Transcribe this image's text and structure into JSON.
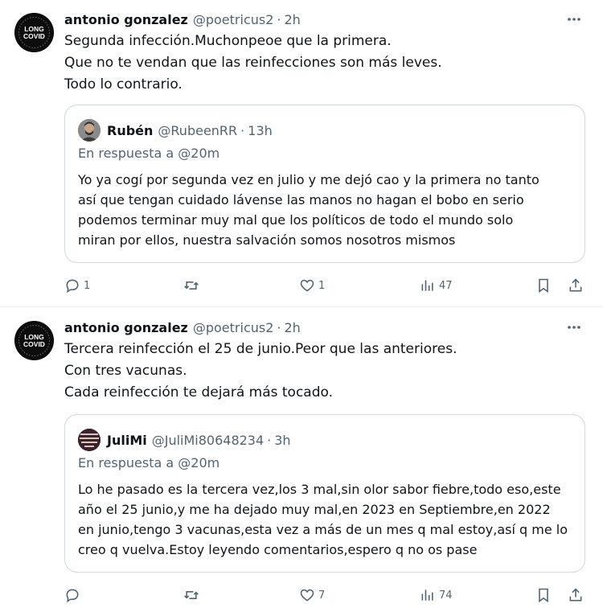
{
  "tweets": [
    {
      "author_name": "antonio gonzalez",
      "author_handle": "@poetricus2",
      "separator": "·",
      "time": "2h",
      "avatar_text": [
        "LONG",
        "COVID"
      ],
      "lines": [
        "Segunda infección.Muchonpeoe que la primera.",
        "Que no te vendan que las reinfecciones son más leves.",
        "Todo lo contrario."
      ],
      "quote": {
        "author_name": "Rubén",
        "author_handle": "@RubeenRR",
        "separator": "·",
        "time": "13h",
        "reply_to": "En respuesta a @20m",
        "lines": [
          "Yo ya cogí por segunda vez en julio y me dejó cao y la primera no tanto",
          "así que tengan cuidado lávense las manos no hagan el bobo en serio",
          "podemos terminar muy mal que los políticos de todo el mundo solo",
          "miran por ellos, nuestra salvación somos nosotros mismos"
        ]
      },
      "counts": {
        "replies": "1",
        "retweets": "",
        "likes": "1",
        "views": "47"
      }
    },
    {
      "author_name": "antonio gonzalez",
      "author_handle": "@poetricus2",
      "separator": "·",
      "time": "2h",
      "avatar_text": [
        "LONG",
        "COVID"
      ],
      "lines": [
        "Tercera reinfección el 25 de junio.Peor que las anteriores.",
        "Con tres vacunas.",
        "Cada reinfección te dejará más tocado."
      ],
      "quote": {
        "author_name": "JuliMi",
        "author_handle": "@JuliMi80648234",
        "separator": "·",
        "time": "3h",
        "reply_to": "En respuesta a @20m",
        "lines": [
          "Lo he pasado es la tercera vez,los 3 mal,sin olor sabor fiebre,todo eso,este",
          "año el 25 junio,y me ha dejado muy mal,en 2023 en Septiembre,en 2022",
          "en junio,tengo 3 vacunas,esta vez a más de un mes q mal estoy,así q me lo",
          "creo q vuelva.Estoy leyendo comentarios,espero q no os pase"
        ]
      },
      "counts": {
        "replies": "",
        "retweets": "",
        "likes": "7",
        "views": "74"
      }
    }
  ],
  "icons": {
    "more": "more-options-icon",
    "reply": "reply-icon",
    "retweet": "retweet-icon",
    "like": "like-icon",
    "views": "views-icon",
    "bookmark": "bookmark-icon",
    "share": "share-icon"
  },
  "colors": {
    "text": "#0f1419",
    "secondary": "#536471",
    "border": "#cfd9de"
  }
}
